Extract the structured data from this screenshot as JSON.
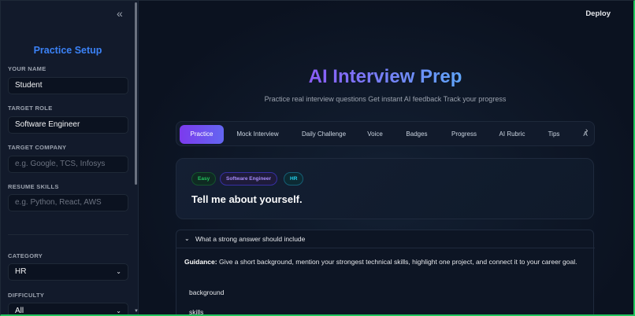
{
  "sidebar": {
    "title": "Practice Setup",
    "name_label": "YOUR NAME",
    "name_value": "Student",
    "role_label": "TARGET ROLE",
    "role_value": "Software Engineer",
    "company_label": "TARGET COMPANY",
    "company_placeholder": "e.g. Google, TCS, Infosys",
    "skills_label": "RESUME SKILLS",
    "skills_placeholder": "e.g. Python, React, AWS",
    "category_label": "CATEGORY",
    "category_value": "HR",
    "difficulty_label": "DIFFICULTY",
    "difficulty_value": "All"
  },
  "header": {
    "deploy_label": "Deploy"
  },
  "main": {
    "title": "AI Interview Prep",
    "subtitle": "Practice real interview questions Get instant AI feedback Track your progress",
    "tabs": [
      "Practice",
      "Mock Interview",
      "Daily Challenge",
      "Voice",
      "Badges",
      "Progress",
      "AI Rubric",
      "Tips",
      "A"
    ],
    "question": {
      "badges": [
        "Easy",
        "Software Engineer",
        "HR"
      ],
      "text": "Tell me about yourself."
    },
    "expander": {
      "title": "What a strong answer should include",
      "guidance_label": "Guidance:",
      "guidance_text": "Give a short background, mention your strongest technical skills, highlight one project, and connect it to your career goal.",
      "keywords": [
        "background",
        "skills"
      ]
    }
  }
}
